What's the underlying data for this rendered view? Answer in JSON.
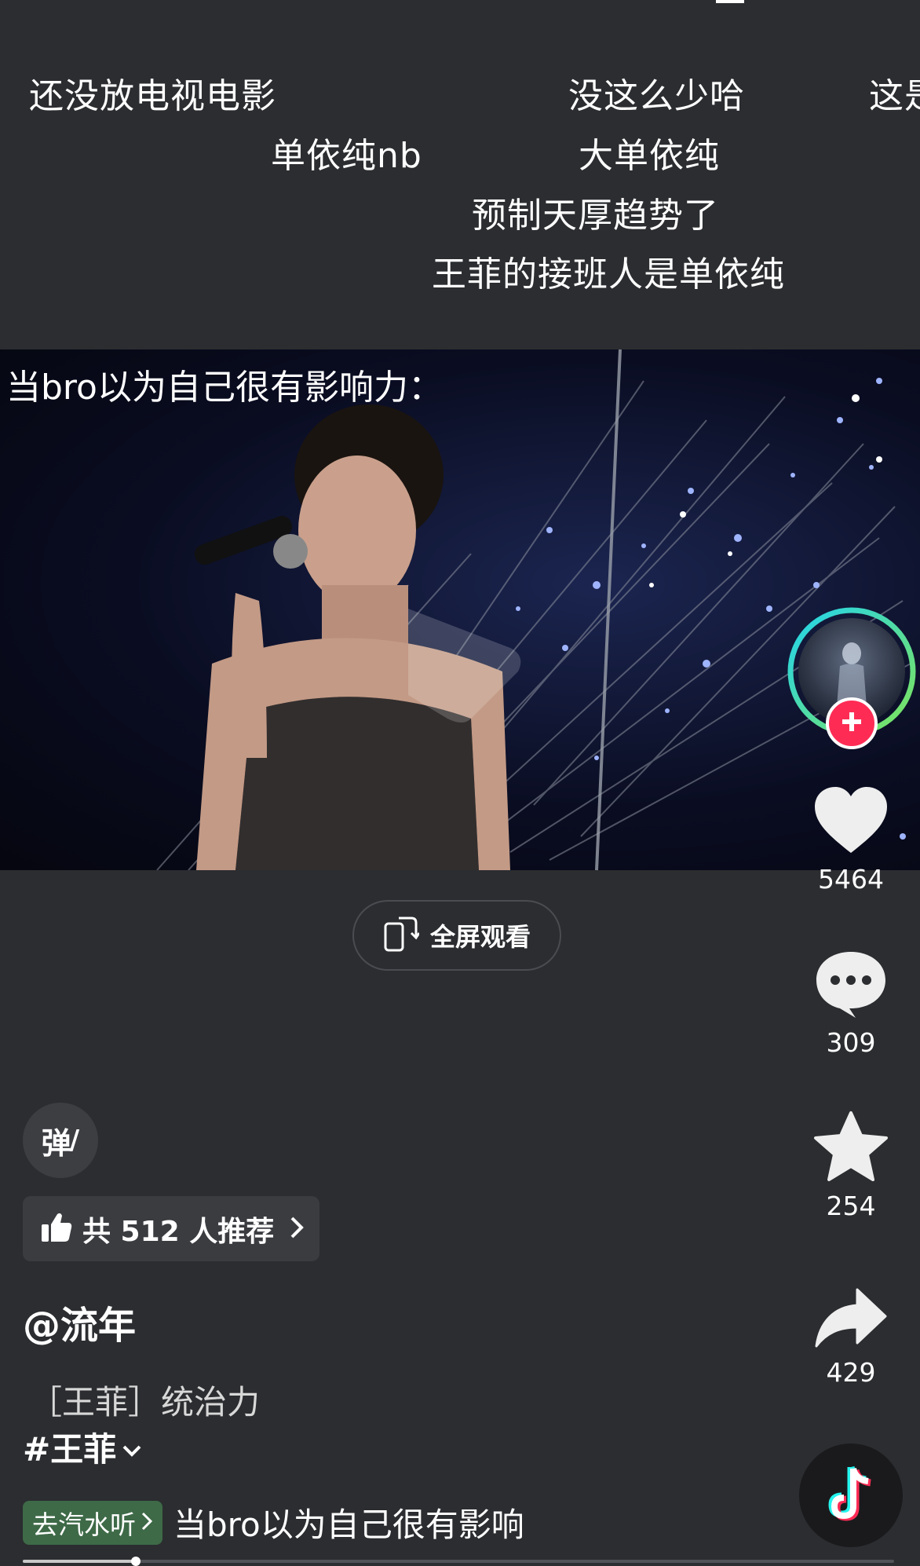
{
  "danmaku": [
    "还没放电视电影",
    "没这么少哈",
    "这是",
    "单依纯nb",
    "大单依纯",
    "预制天厚趋势了",
    "王菲的接班人是单依纯"
  ],
  "video": {
    "caption": "当bro以为自己很有影响力："
  },
  "fullscreen": {
    "label": "全屏观看"
  },
  "rail": {
    "likes": "5464",
    "comments": "309",
    "favorites": "254",
    "shares": "429"
  },
  "danmu_toggle": {
    "label": "弹"
  },
  "recommend": {
    "label": "共 512 人推荐"
  },
  "post": {
    "author": "@流年",
    "description": "［王菲］统治力",
    "hashtag": "#王菲"
  },
  "music": {
    "pill_label": "去汽水听",
    "title": "当bro以为自己很有影响"
  },
  "playback": {
    "progress_fraction": 0.13
  },
  "colors": {
    "background": "#2b2d30",
    "like_red": "#fe2c55",
    "ring_cyan": "#22d3ee",
    "ring_green": "#7fe45a",
    "music_green": "#3e6a47"
  }
}
